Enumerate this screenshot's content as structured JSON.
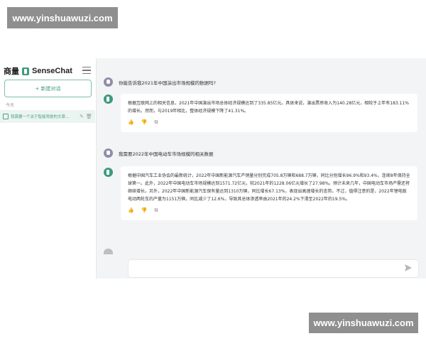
{
  "watermarks": {
    "top": "www.yinshuawuzi.com",
    "bottom": "www.yinshuawuzi.com"
  },
  "sidebar": {
    "brand_cn": "商量",
    "brand_en": "SenseChat",
    "new_chat_label": "+ 新建对话",
    "section_label": "今天",
    "history": [
      {
        "title": "我需要一个关于智能驾驶的文章..."
      }
    ]
  },
  "conversation": [
    {
      "user": "你能告诉我2021年中国演出市场规模的数据吗?",
      "bot": "根据互联网上的相关信息，2021年中国演出市场总体经济规模达到了335.85亿元。具体来说，演出票房收入为140.28亿元，相较于上年有183.11%的增长。然而，与2019年相比，整体经济规模下降了41.31%。"
    },
    {
      "user": "我需要2022年中国电动车市场规模的相关数据",
      "bot": "根据中国汽车工业协会的最新统计，2022年中国新能源汽车产销量分别完成705.8万辆和688.7万辆，同比分别增长96.9%和93.4%，连续8年保持全球第一。此外，2022年中国电动车市场规模达到1571.72亿元，较2021年的1228.06亿元增长了27.98%。预计未来几年，中国电动车市场产需还将继续增长。另外，2022年中国新能源汽车保有量达到1310万辆，同比增长67.13%，表现出高速增长的态势。不过，值得注意的是，2022年锂电版电动两轮车的产量为1151万辆，同比减少了12.6%，导致其总体渗透率由2021年的24.2%下滑至2022年的19.5%。"
    }
  ],
  "input": {
    "placeholder": ""
  },
  "icons": {
    "menu": "menu-icon",
    "edit": "edit-icon",
    "delete": "trash-icon",
    "like": "thumbs-up-icon",
    "dislike": "thumbs-down-icon",
    "copy": "copy-icon",
    "send": "send-icon"
  },
  "colors": {
    "accent": "#3f9a7d",
    "main_bg": "#f3f4f6",
    "watermark_bg": "#8f8f8f"
  }
}
